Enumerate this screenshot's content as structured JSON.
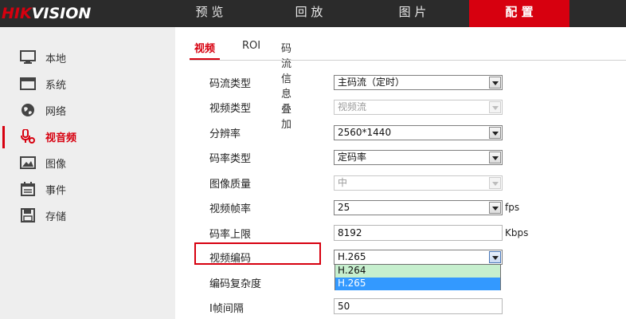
{
  "brand": {
    "logo_red": "HIK",
    "logo_white": "VISION",
    "accent": "#d7000f"
  },
  "topnav": {
    "items": [
      {
        "label": "预 览"
      },
      {
        "label": "回 放"
      },
      {
        "label": "图 片"
      },
      {
        "label": "配 置",
        "active": true
      }
    ]
  },
  "sidebar": {
    "items": [
      {
        "label": "本地",
        "icon": "monitor-icon"
      },
      {
        "label": "系统",
        "icon": "window-icon"
      },
      {
        "label": "网络",
        "icon": "globe-icon"
      },
      {
        "label": "视音频",
        "icon": "microphone-icon",
        "active": true
      },
      {
        "label": "图像",
        "icon": "image-icon"
      },
      {
        "label": "事件",
        "icon": "calendar-icon"
      },
      {
        "label": "存储",
        "icon": "floppy-disk-icon"
      }
    ]
  },
  "tabs": [
    {
      "label": "视频",
      "active": true
    },
    {
      "label": "ROI"
    },
    {
      "label": "码流信息叠加"
    }
  ],
  "form": {
    "stream_type": {
      "label": "码流类型",
      "value": "主码流（定时）"
    },
    "video_type": {
      "label": "视频类型",
      "value": "视频流"
    },
    "resolution": {
      "label": "分辨率",
      "value": "2560*1440"
    },
    "bitrate_type": {
      "label": "码率类型",
      "value": "定码率"
    },
    "image_quality": {
      "label": "图像质量",
      "value": "中"
    },
    "frame_rate": {
      "label": "视频帧率",
      "value": "25",
      "unit": "fps"
    },
    "max_bitrate": {
      "label": "码率上限",
      "value": "8192",
      "unit": "Kbps"
    },
    "video_encoding": {
      "label": "视频编码",
      "value": "H.265",
      "options": [
        "H.264",
        "H.265"
      ],
      "selected_option": "H.265"
    },
    "encoding_complexity": {
      "label": "编码复杂度"
    },
    "i_frame_interval": {
      "label": "I帧间隔",
      "value": "50"
    }
  }
}
